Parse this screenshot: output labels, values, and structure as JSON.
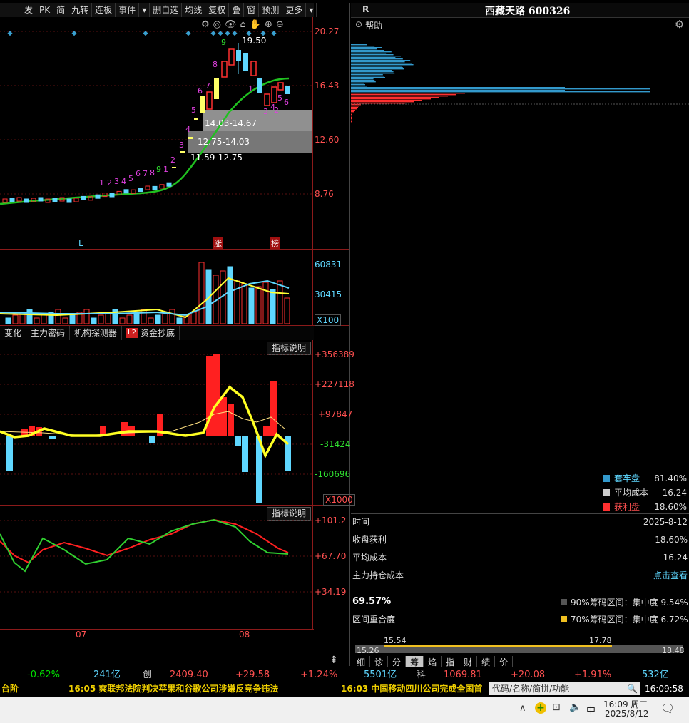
{
  "toolbar": {
    "items": [
      "发",
      "PK",
      "简",
      "九转",
      "连板",
      "事件",
      "▾",
      "删自选",
      "均线",
      "复权",
      "叠",
      "窗",
      "预测",
      "更多",
      "▾"
    ]
  },
  "price_axis": [
    "20.27",
    "16.43",
    "12.60",
    "8.76"
  ],
  "candles_panel": {
    "high_label": "19.50",
    "range_labels": [
      "14.03-14.67",
      "12.75-14.03",
      "11.59-12.75"
    ],
    "markers": [
      "L",
      "涨",
      "榜"
    ],
    "td_counts_green": [
      "9",
      "9"
    ]
  },
  "volume_axis": [
    "60831",
    "30415",
    "X100"
  ],
  "indicator_tabs": [
    "变化",
    "主力密码",
    "机构探测器",
    "L2",
    "资金抄底"
  ],
  "explain_label": "指标说明",
  "flow_axis": [
    "+356389",
    "+227118",
    "+97847",
    "-31424",
    "-160696",
    "X1000"
  ],
  "kdj_axis": [
    "+101.2",
    "+67.70",
    "+34.19"
  ],
  "month_labels": [
    "07",
    "08"
  ],
  "right_panel": {
    "r_label": "R",
    "title": "西藏天路 600326",
    "help": "帮助",
    "legend": [
      {
        "name": "套牢盘",
        "value": "81.40%",
        "color": "#3399cc"
      },
      {
        "name": "平均成本",
        "value": "16.24",
        "color": "#cccccc"
      },
      {
        "name": "获利盘",
        "value": "18.60%",
        "color": "#ff3030"
      }
    ],
    "rows": [
      {
        "label": "时间",
        "value": "2025-8-12"
      },
      {
        "label": "收盘获利",
        "value": "18.60%"
      },
      {
        "label": "平均成本",
        "value": "16.24"
      },
      {
        "label": "主力持仓成本",
        "value": "点击查看"
      }
    ],
    "concentration_pct": "69.57%",
    "overlap_label": "区间重合度",
    "c90": "90%筹码区间：集中度  9.54%",
    "c70": "70%筹码区间：集中度  6.72%",
    "range_bar": {
      "low": "15.26",
      "mid1": "15.54",
      "mid2": "17.78",
      "high": "18.48"
    },
    "bottom_tabs": [
      "细",
      "诊",
      "分",
      "筹",
      "焰",
      "指",
      "财",
      "绩",
      "价"
    ]
  },
  "ticker": {
    "items": [
      {
        "text": "-0.62%",
        "color": "#00e000"
      },
      {
        "text": "241亿",
        "color": "#5fd7ff"
      },
      {
        "text": "创",
        "color": "#c8c8c8"
      },
      {
        "text": "2409.40",
        "color": "#ff5050"
      },
      {
        "text": "+29.58",
        "color": "#ff5050"
      },
      {
        "text": "+1.24%",
        "color": "#ff5050"
      },
      {
        "text": "5501亿",
        "color": "#5fd7ff"
      },
      {
        "text": "科",
        "color": "#c8c8c8"
      },
      {
        "text": "1069.81",
        "color": "#ff5050"
      },
      {
        "text": "+20.08",
        "color": "#ff5050"
      },
      {
        "text": "+1.91%",
        "color": "#ff5050"
      },
      {
        "text": "532亿",
        "color": "#5fd7ff"
      }
    ]
  },
  "news": {
    "left": "台阶",
    "item1": "16:05 爽联邦法院判决苹果和谷歌公司涉嫌反竞争违法",
    "item2": "16:03 中国移动四川公司完成全国首",
    "search_placeholder": "代码/名称/简拼/功能",
    "clock": "16:09:58"
  },
  "taskbar": {
    "ime": "中",
    "time": "16:09 周二",
    "date": "2025/8/12"
  }
}
